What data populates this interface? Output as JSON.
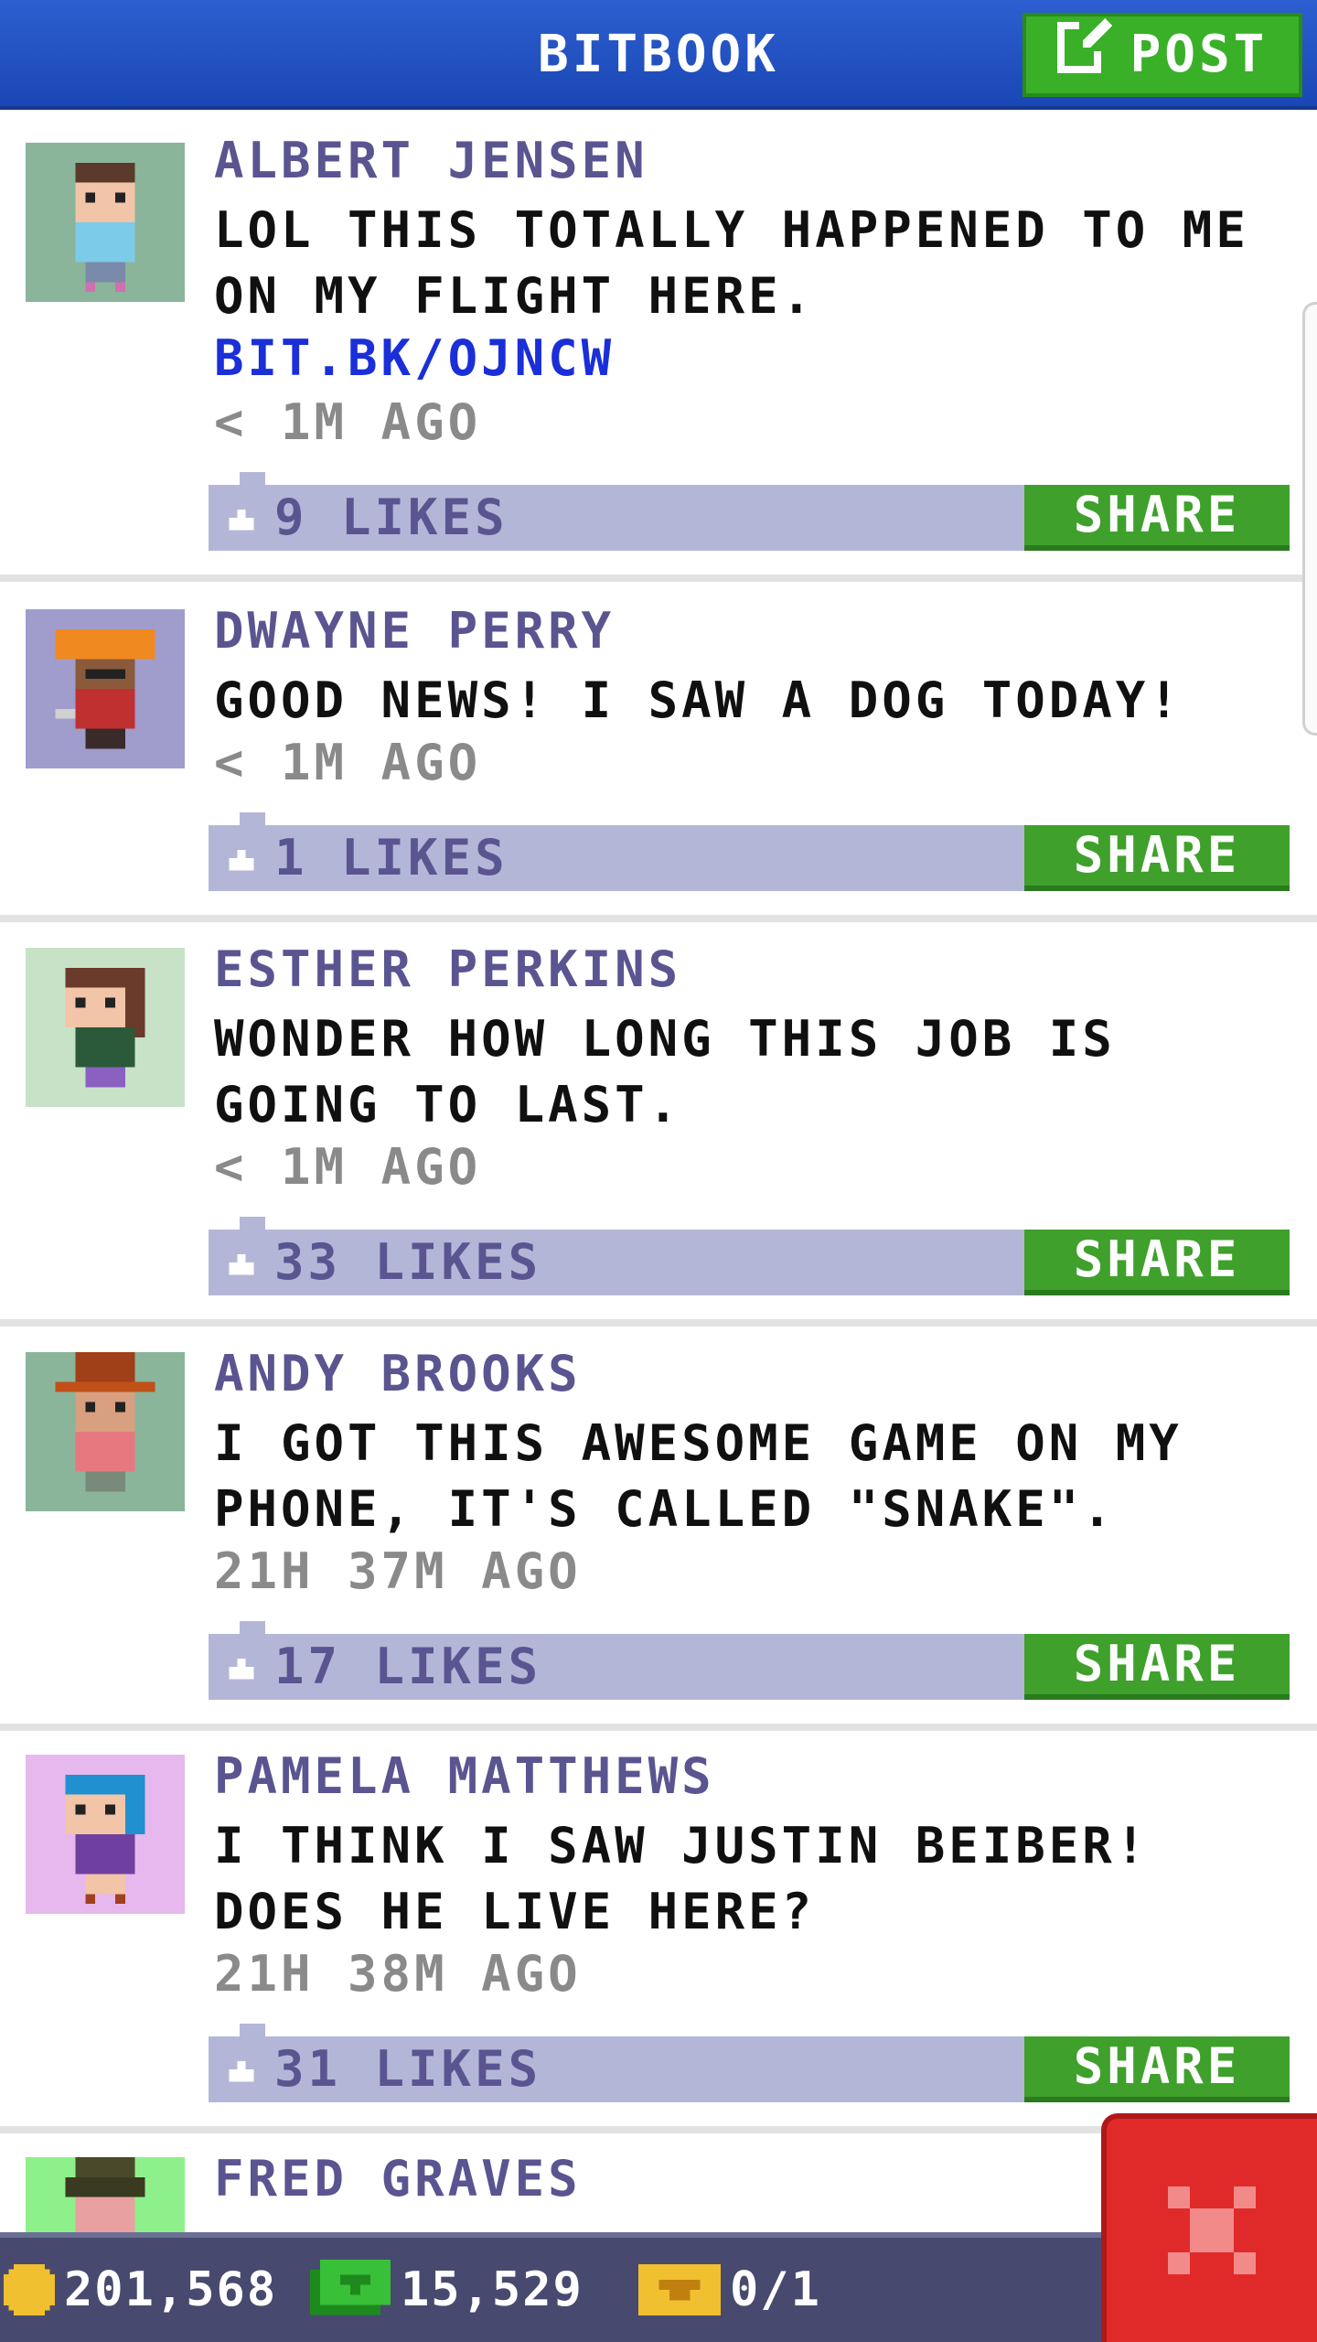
{
  "header": {
    "title": "BITBOOK",
    "post_label": "POST"
  },
  "posts": [
    {
      "name": "ALBERT JENSEN",
      "message": "LOL THIS TOTALLY HAPPENED TO ME ON MY FLIGHT HERE.",
      "link": "BIT.BK/OJNCW",
      "time": "< 1M AGO",
      "likes": "9 LIKES",
      "share": "SHARE",
      "avatar_bg": "#8ab59a"
    },
    {
      "name": "DWAYNE PERRY",
      "message": "GOOD NEWS! I SAW A DOG TODAY!",
      "time": "< 1M AGO",
      "likes": "1 LIKES",
      "share": "SHARE",
      "avatar_bg": "#a09ccc"
    },
    {
      "name": "ESTHER PERKINS",
      "message": "WONDER HOW LONG THIS JOB IS GOING TO LAST.",
      "time": "< 1M AGO",
      "likes": "33 LIKES",
      "share": "SHARE",
      "avatar_bg": "#c8e2c8"
    },
    {
      "name": "ANDY BROOKS",
      "message": "I GOT THIS AWESOME GAME ON MY PHONE, IT'S CALLED \"SNAKE\".",
      "time": "21H 37M AGO",
      "likes": "17 LIKES",
      "share": "SHARE",
      "avatar_bg": "#8ab59a"
    },
    {
      "name": "PAMELA MATTHEWS",
      "message": "I THINK I SAW JUSTIN BEIBER! DOES HE LIVE HERE?",
      "time": "21H 38M AGO",
      "likes": "31 LIKES",
      "share": "SHARE",
      "avatar_bg": "#e6b8ee"
    },
    {
      "name": "FRED GRAVES",
      "avatar_bg": "#8ef08a"
    }
  ],
  "bottom_bar": {
    "coins": "201,568",
    "bux": "15,529",
    "tickets": "0/1"
  },
  "colors": {
    "header_blue": "#1f4fc4",
    "post_green": "#39b028",
    "share_green": "#3fa02c",
    "likes_bar": "#b4b6d8",
    "name_purple": "#5a5590",
    "close_red": "#e02a2a"
  }
}
